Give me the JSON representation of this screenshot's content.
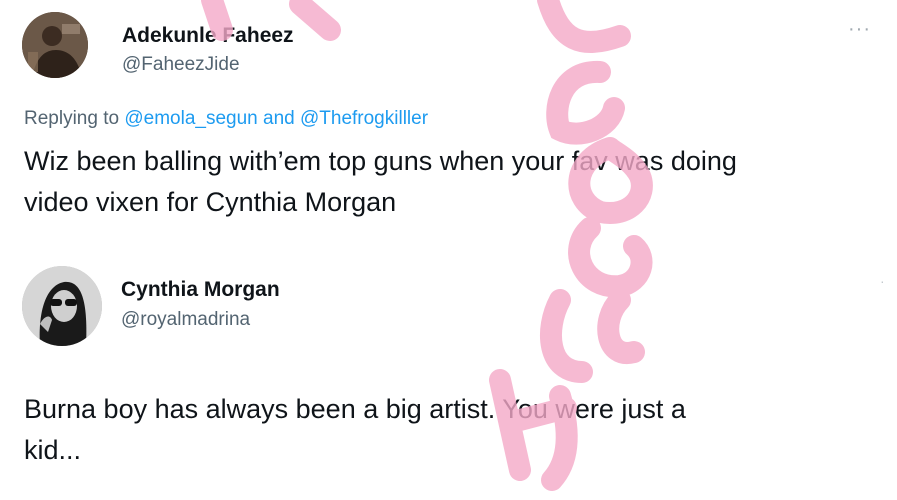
{
  "tweets": [
    {
      "author_name": "Adekunle Faheez",
      "author_handle": "@FaheezJide",
      "more_icon": "more-icon",
      "reply": {
        "prefix": "Replying to",
        "mention_1": "@emola_segun",
        "conjunction": "and",
        "mention_2": "@Thefrogkilller"
      },
      "text": "Wiz been balling with’em top guns when your fav was doing\nvideo vixen for Cynthia Morgan"
    },
    {
      "author_name": "Cynthia Morgan",
      "author_handle": "@royalmadrina",
      "text": "Burna boy has always been a big artist. You were just a\nkid..."
    }
  ],
  "colors": {
    "text": "#0f1419",
    "secondary": "#536471",
    "link": "#1d9bf0",
    "watermark": "#f4a9c8"
  }
}
